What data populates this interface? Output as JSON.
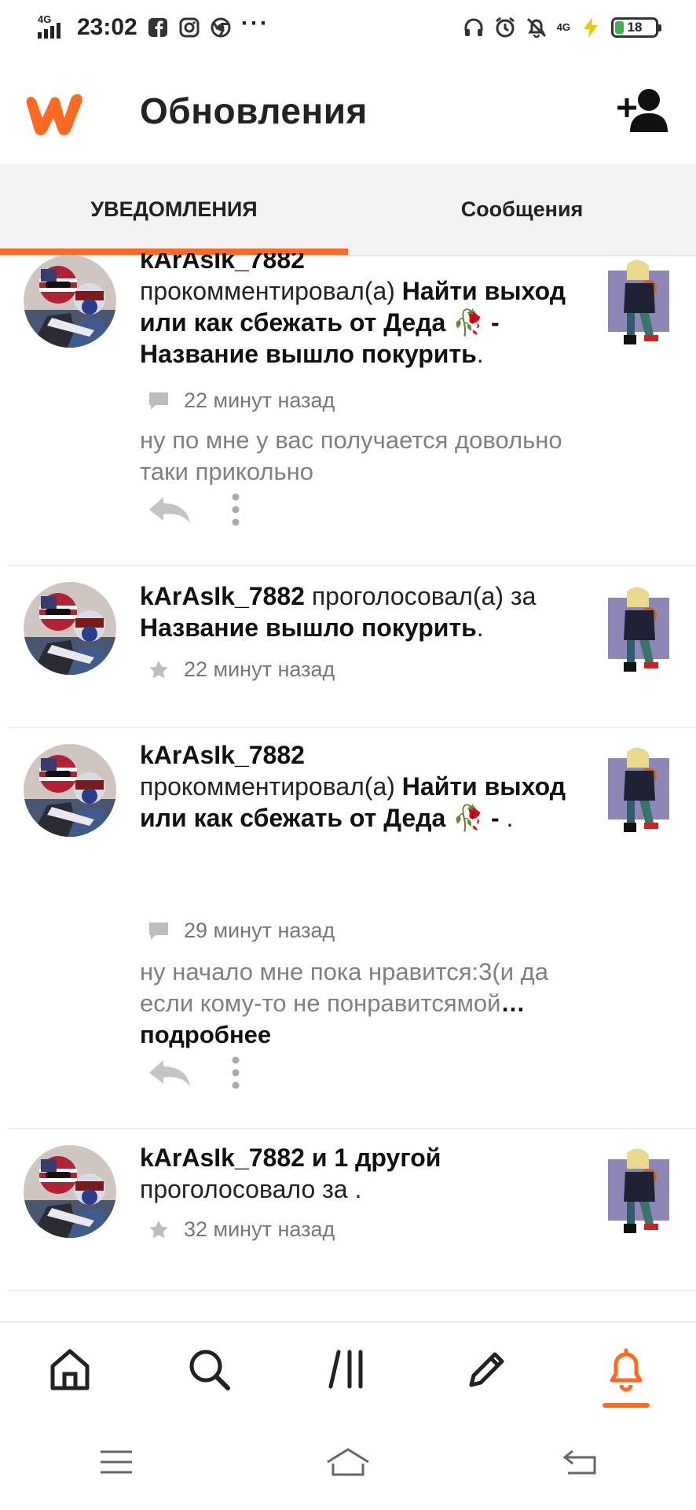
{
  "status_bar": {
    "network_label": "4G",
    "time": "23:02",
    "network_label_right": "4G",
    "battery_level": "18",
    "more": "···"
  },
  "header": {
    "title": "Обновления"
  },
  "tabs": [
    {
      "label": "УВЕДОМЛЕНИЯ",
      "active": true
    },
    {
      "label": "Сообщения",
      "active": false
    }
  ],
  "notifications": [
    {
      "user": "kArAsIk_7882",
      "action": "прокомментировал(а)",
      "story": "Найти выход или как сбежать от Деда 🥀 - Название вышло покурить",
      "end": ".",
      "time": "22 минут назад",
      "comment": "ну по мне у вас получается довольно таки прикольно"
    },
    {
      "user": "kArAsIk_7882",
      "action": "проголосовал(а) за",
      "story": "Название вышло покурить",
      "end": ".",
      "time": "22 минут назад"
    },
    {
      "user": "kArAsIk_7882",
      "action": "прокомментировал(а)",
      "story": "Найти выход или как сбежать от Деда 🥀 - ",
      "end": ".",
      "time": "29 минут назад",
      "comment": "ну начало мне пока  нравится:3(и да если кому-то  не понравитсямой",
      "more": "… подробнее"
    },
    {
      "user": "kArAsIk_7882 и 1 другой",
      "action": "проголосовало за",
      "end": " .",
      "time": "32 минут назад"
    }
  ],
  "colors": {
    "accent": "#ff6a21",
    "text": "#222222",
    "muted": "#777777"
  }
}
